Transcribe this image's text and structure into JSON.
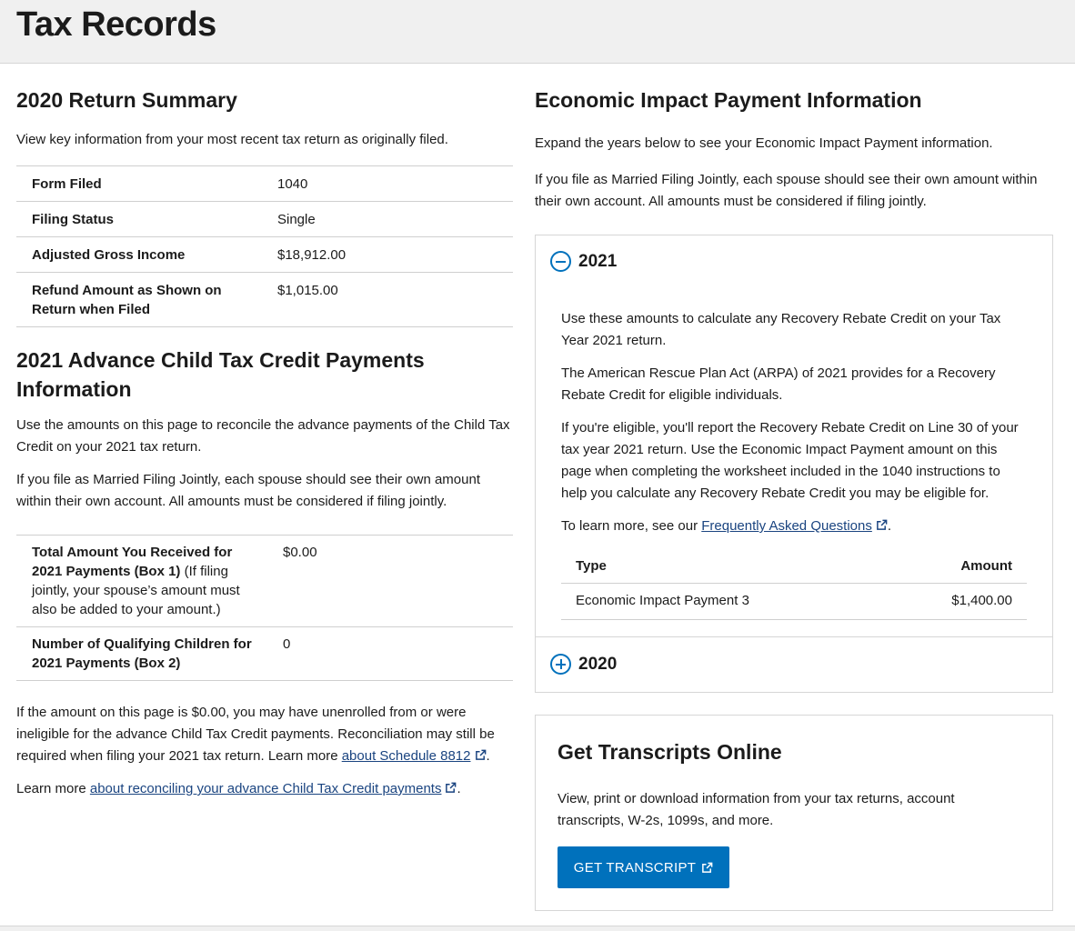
{
  "page": {
    "title": "Tax Records"
  },
  "return_summary": {
    "title": "2020 Return Summary",
    "description": "View key information from your most recent tax return as originally filed.",
    "rows": [
      {
        "label": "Form Filed",
        "value": "1040"
      },
      {
        "label": "Filing Status",
        "value": "Single"
      },
      {
        "label": "Adjusted Gross Income",
        "value": "$18,912.00"
      },
      {
        "label": "Refund Amount as Shown on Return when Filed",
        "value": "$1,015.00"
      }
    ]
  },
  "child_tax_credit": {
    "title": "2021 Advance Child Tax Credit Payments Information",
    "desc_1": "Use the amounts on this page to reconcile the advance payments of the Child Tax Credit on your 2021 tax return.",
    "desc_2": "If you file as Married Filing Jointly, each spouse should see their own amount within their own account. All amounts must be considered if filing jointly.",
    "rows": [
      {
        "label": "Total Amount You Received for 2021 Payments (Box 1)",
        "note": " (If filing jointly, your spouse’s amount must also be added to your amount.)",
        "value": "$0.00"
      },
      {
        "label": "Number of Qualifying Children for 2021 Payments (Box 2)",
        "note": "",
        "value": "0"
      }
    ],
    "note_1_text": "If the amount on this page is $0.00, you may have unenrolled from or were ineligible for the advance Child Tax Credit payments. Reconciliation may still be required when filing your 2021 tax return. Learn more ",
    "note_1_link": "about Schedule 8812",
    "note_1_end": ".",
    "note_2_text": "Learn more ",
    "note_2_link": "about reconciling your advance Child Tax Credit payments",
    "note_2_end": "."
  },
  "eip": {
    "title": "Economic Impact Payment Information",
    "desc_1": "Expand the years below to see your Economic Impact Payment information.",
    "desc_2": "If you file as Married Filing Jointly, each spouse should see their own amount within their own account. All amounts must be considered if filing jointly.",
    "accordion": {
      "year_2021": "2021",
      "year_2020": "2020",
      "body_1": "Use these amounts to calculate any Recovery Rebate Credit on your Tax Year 2021 return.",
      "body_2": "The American Rescue Plan Act (ARPA) of 2021 provides for a Recovery Rebate Credit for eligible individuals.",
      "body_3": "If you're eligible, you'll report the Recovery Rebate Credit on Line 30 of your tax year 2021 return. Use the Economic Impact Payment amount on this page when completing the worksheet included in the 1040 instructions to help you calculate any Recovery Rebate Credit you may be eligible for.",
      "learn_text": "To learn more, see our ",
      "learn_link": "Frequently Asked Questions",
      "learn_end": ".",
      "table": {
        "col_type": "Type",
        "col_amount": "Amount",
        "rows": [
          {
            "type": "Economic Impact Payment 3",
            "amount": "$1,400.00"
          }
        ]
      }
    }
  },
  "transcripts": {
    "title": "Get Transcripts Online",
    "description": "View, print or download information from your tax returns, account transcripts, W-2s, 1099s, and more.",
    "button": "GET TRANSCRIPT"
  },
  "colors": {
    "link": "#1a4480",
    "accent": "#0071bc",
    "header_bg": "#f0f0f0"
  },
  "icons": {
    "external_link": "external-link-icon",
    "collapse": "minus-circle-icon",
    "expand": "plus-circle-icon"
  }
}
